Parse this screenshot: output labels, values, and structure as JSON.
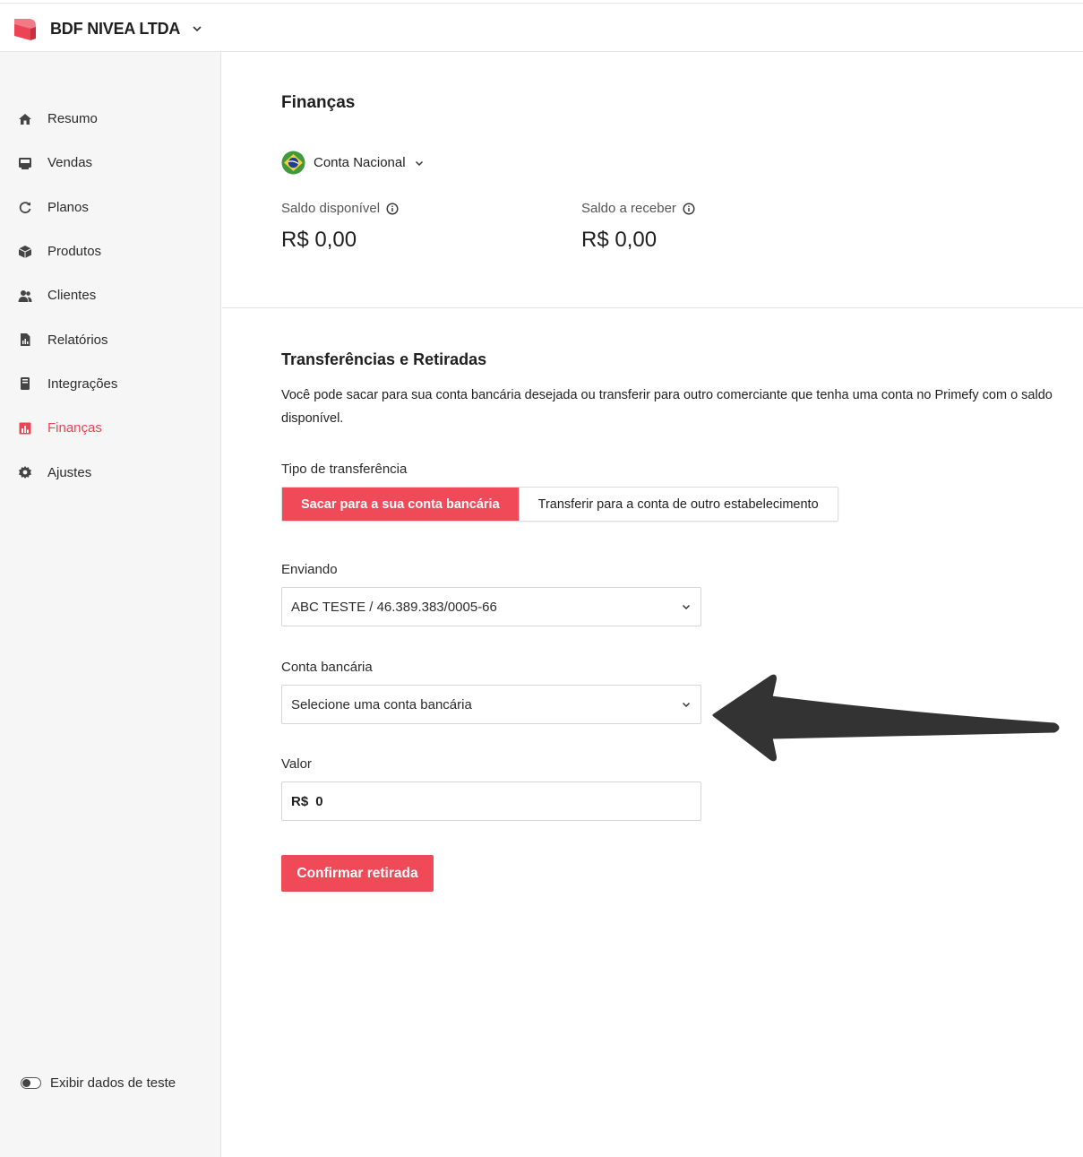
{
  "header": {
    "company_name": "BDF NIVEA LTDA"
  },
  "sidebar": {
    "items": [
      {
        "label": "Resumo",
        "icon": "home-icon",
        "active": false
      },
      {
        "label": "Vendas",
        "icon": "sales-icon",
        "active": false
      },
      {
        "label": "Planos",
        "icon": "refresh-icon",
        "active": false
      },
      {
        "label": "Produtos",
        "icon": "box-icon",
        "active": false
      },
      {
        "label": "Clientes",
        "icon": "users-icon",
        "active": false
      },
      {
        "label": "Relatórios",
        "icon": "report-icon",
        "active": false
      },
      {
        "label": "Integrações",
        "icon": "integration-icon",
        "active": false
      },
      {
        "label": "Finanças",
        "icon": "finance-icon",
        "active": true
      },
      {
        "label": "Ajustes",
        "icon": "gear-icon",
        "active": false
      }
    ],
    "test_data_toggle_label": "Exibir dados de teste",
    "test_data_toggle_on": false
  },
  "finance": {
    "title": "Finanças",
    "account_selector": "Conta Nacional",
    "available_balance": {
      "label": "Saldo disponível",
      "value": "R$ 0,00"
    },
    "receivable_balance": {
      "label": "Saldo a receber",
      "value": "R$ 0,00"
    }
  },
  "transfers": {
    "title": "Transferências e Retiradas",
    "description": "Você pode sacar para sua conta bancária desejada ou transferir para outro comerciante que tenha uma conta no Primefy com o saldo disponível.",
    "type_label": "Tipo de transferência",
    "type_options": [
      "Sacar para a sua conta bancária",
      "Transferir para a conta de outro estabelecimento"
    ],
    "type_selected": "Sacar para a sua conta bancária",
    "sender_label": "Enviando",
    "sender_value": "ABC TESTE / 46.389.383/0005-66",
    "bank_account_label": "Conta bancária",
    "bank_account_placeholder": "Selecione uma conta bancária",
    "amount_label": "Valor",
    "amount_prefix": "R$",
    "amount_value": "0",
    "confirm_label": "Confirmar retirada"
  },
  "colors": {
    "accent": "#f04a58",
    "active_nav": "#ec4455",
    "annotation_arrow": "#333333"
  }
}
